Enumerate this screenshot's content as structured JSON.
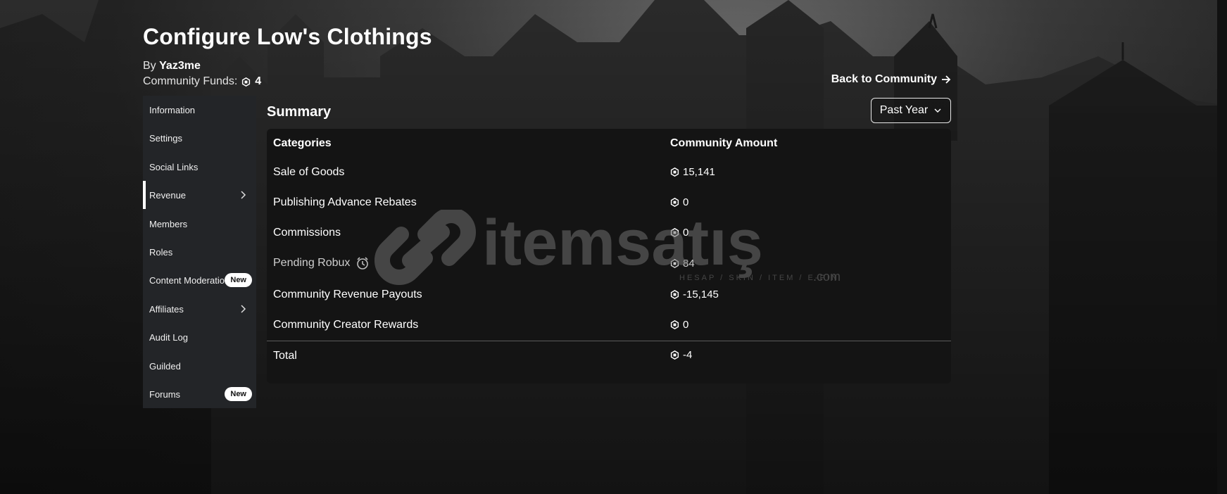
{
  "page": {
    "title": "Configure Low's Clothings",
    "by_prefix": "By",
    "owner": "Yaz3me",
    "funds_label": "Community Funds:",
    "funds_value": "4",
    "back_link": "Back to Community",
    "currency_icon": "robux-icon"
  },
  "sidebar": {
    "items": [
      {
        "label": "Information"
      },
      {
        "label": "Settings"
      },
      {
        "label": "Social Links"
      },
      {
        "label": "Revenue",
        "active": true,
        "has_chevron": true
      },
      {
        "label": "Members"
      },
      {
        "label": "Roles"
      },
      {
        "label": "Content Moderation",
        "badge": "New"
      },
      {
        "label": "Affiliates",
        "has_chevron": true
      },
      {
        "label": "Audit Log"
      },
      {
        "label": "Guilded"
      },
      {
        "label": "Forums",
        "badge": "New"
      }
    ]
  },
  "summary": {
    "title": "Summary",
    "period": "Past Year",
    "columns": [
      "Categories",
      "Community Amount"
    ],
    "rows": [
      {
        "category": "Sale of Goods",
        "amount": "15,141"
      },
      {
        "category": "Publishing Advance Rebates",
        "amount": "0"
      },
      {
        "category": "Commissions",
        "amount": "0"
      },
      {
        "category": "Pending Robux",
        "amount": "84",
        "pending": true
      },
      {
        "category": "Community Revenue Payouts",
        "amount": "-15,145"
      },
      {
        "category": "Community Creator Rewards",
        "amount": "0"
      }
    ],
    "total_label": "Total",
    "total_amount": "-4"
  },
  "watermark": {
    "brand": "itemsatış",
    "tagline": "HESAP / SKIN / ITEM / E-PIN",
    "suffix": ".com"
  },
  "colors": {
    "panel": "#141414",
    "sidebar": "#232528",
    "accent": "#ffffff"
  }
}
